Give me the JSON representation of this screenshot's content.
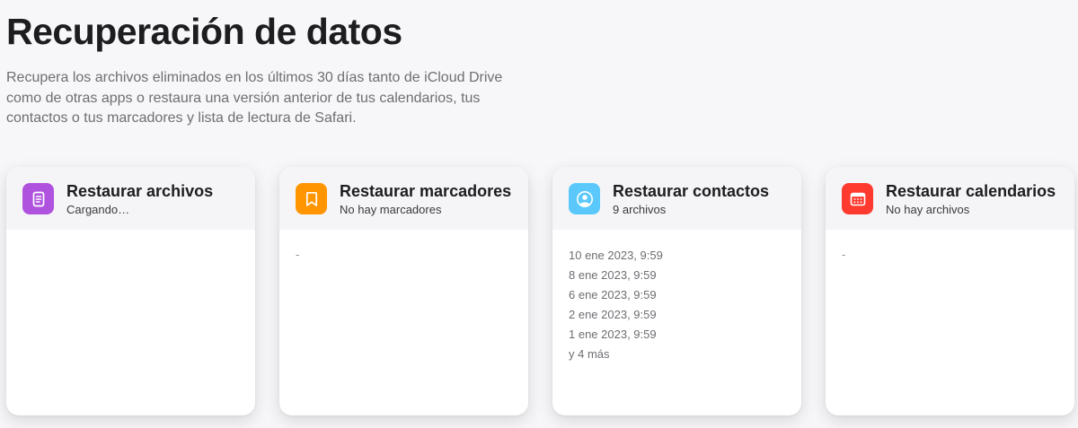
{
  "page": {
    "title": "Recuperación de datos",
    "description": "Recupera los archivos eliminados en los últimos 30 días tanto de iCloud Drive como de otras apps o restaura una versión anterior de tus calendarios, tus contactos o tus marcadores y lista de lectura de Safari."
  },
  "cards": [
    {
      "title": "Restaurar archivos",
      "subtitle": "Cargando…",
      "icon": "document-icon",
      "color": "#af52de",
      "items": []
    },
    {
      "title": "Restaurar marcadores",
      "subtitle": "No hay marcadores",
      "icon": "bookmark-icon",
      "color": "#ff9500",
      "placeholder": "-"
    },
    {
      "title": "Restaurar contactos",
      "subtitle": "9 archivos",
      "icon": "contact-icon",
      "color": "#5ac8fa",
      "items": [
        "10 ene 2023, 9:59",
        "8 ene 2023, 9:59",
        "6 ene 2023, 9:59",
        "2 ene 2023, 9:59",
        "1 ene 2023, 9:59",
        "y 4 más"
      ]
    },
    {
      "title": "Restaurar calendarios",
      "subtitle": "No hay archivos",
      "icon": "calendar-icon",
      "color": "#ff3b30",
      "placeholder": "-"
    }
  ]
}
